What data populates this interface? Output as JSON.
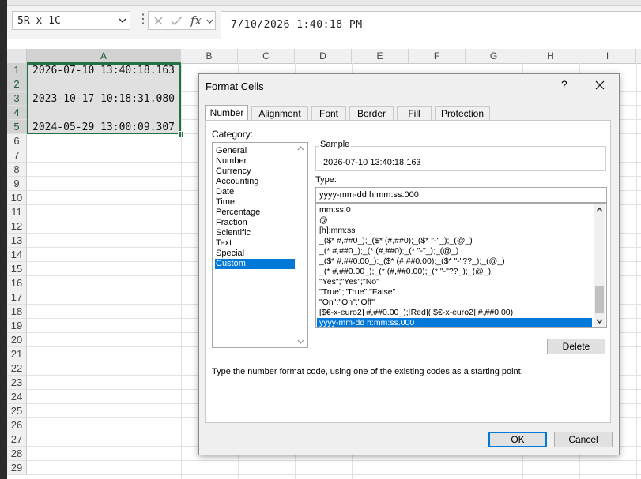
{
  "formula_bar": {
    "name_box": "5R x 1C",
    "formula": "7/10/2026  1:40:18 PM"
  },
  "sheet": {
    "columns": [
      "A",
      "B",
      "C",
      "D",
      "E",
      "F",
      "G",
      "H",
      "I"
    ],
    "rows": [
      "1",
      "2",
      "3",
      "4",
      "5",
      "6",
      "7",
      "8",
      "9",
      "10",
      "11",
      "12",
      "13",
      "14",
      "15",
      "16",
      "17",
      "18",
      "19",
      "20",
      "21",
      "22",
      "23",
      "24",
      "25",
      "26",
      "27",
      "28",
      "29"
    ],
    "cells": {
      "A1": "2026-07-10 13:40:18.163",
      "A3": "2023-10-17 10:18:31.080",
      "A5": "2024-05-29 13:00:09.307"
    }
  },
  "dialog": {
    "title": "Format Cells",
    "help": "?",
    "tabs": [
      "Number",
      "Alignment",
      "Font",
      "Border",
      "Fill",
      "Protection"
    ],
    "category_label": "Category:",
    "categories": [
      "General",
      "Number",
      "Currency",
      "Accounting",
      "Date",
      "Time",
      "Percentage",
      "Fraction",
      "Scientific",
      "Text",
      "Special",
      "Custom"
    ],
    "selected_category": "Custom",
    "sample_label": "Sample",
    "sample_value": "2026-07-10 13:40:18.163",
    "type_label": "Type:",
    "type_value": "yyyy-mm-dd h:mm:ss.000",
    "type_list": [
      "mm:ss.0",
      "@",
      "[h]:mm:ss",
      "_($* #,##0_);_($* (#,##0);_($* \"-\"_);_(@_)",
      "_(* #,##0_);_(* (#,##0);_(* \"-\"_);_(@_)",
      "_($* #,##0.00_);_($* (#,##0.00);_($* \"-\"??_);_(@_)",
      "_(* #,##0.00_);_(* (#,##0.00);_(* \"-\"??_);_(@_)",
      "\"Yes\";\"Yes\";\"No\"",
      "\"True\";\"True\";\"False\"",
      "\"On\";\"On\";\"Off\"",
      "[$€-x-euro2] #,##0.00_);[Red]([$€-x-euro2] #,##0.00)",
      "yyyy-mm-dd h:mm:ss.000"
    ],
    "selected_type_index": 11,
    "delete_label": "Delete",
    "hint": "Type the number format code, using one of the existing codes as a starting point.",
    "ok_label": "OK",
    "cancel_label": "Cancel"
  },
  "colors": {
    "selection_border": "#217346",
    "accent": "#0078d7"
  },
  "icons": [
    "chevron-down-icon",
    "cancel-x-icon",
    "check-icon",
    "fx-icon",
    "close-icon",
    "scroll-up-icon",
    "scroll-down-icon"
  ]
}
